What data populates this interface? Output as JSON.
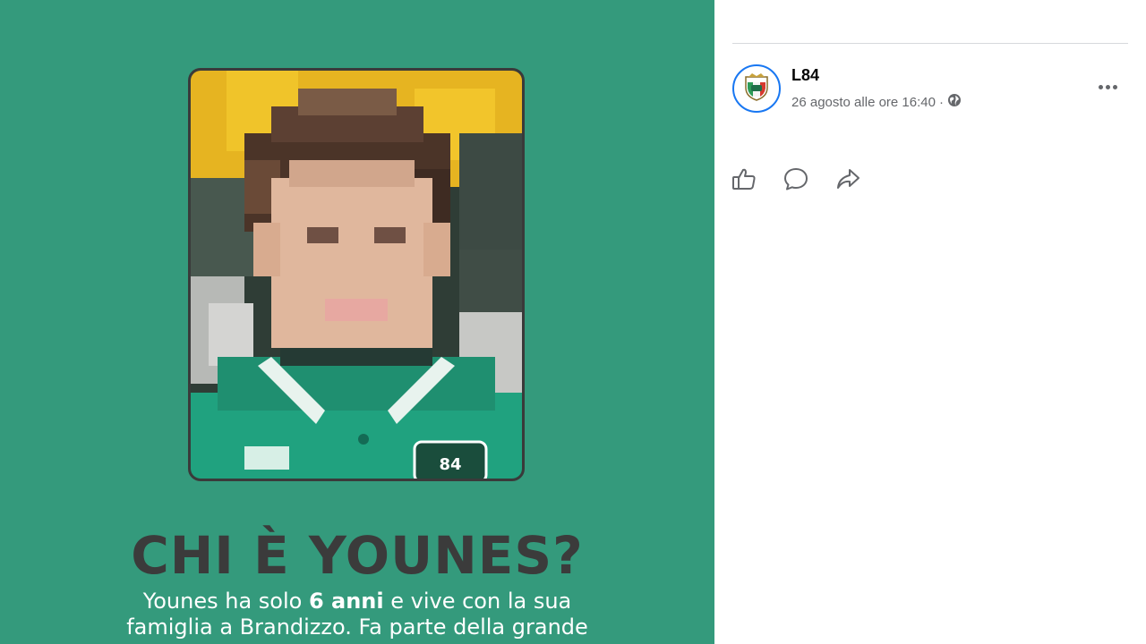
{
  "post_image": {
    "headline": "CHI È YOUNES?",
    "caption_line1_prefix": "Younes ha solo ",
    "caption_line1_bold": "6 anni",
    "caption_line1_suffix": " e vive con la sua",
    "caption_line2": "famiglia a Brandizzo. Fa parte della grande",
    "jersey_badge_text": "84",
    "colors": {
      "background": "#349a7c",
      "headline": "#3b3b3b",
      "caption": "#ffffff"
    }
  },
  "post_header": {
    "page_name": "L84",
    "timestamp": "26 agosto alle ore 16:40",
    "separator": "·",
    "audience_icon": "globe-icon",
    "avatar_icon": "club-crest-icon"
  },
  "actions": [
    {
      "name": "like",
      "icon": "thumbs-up-icon"
    },
    {
      "name": "comment",
      "icon": "speech-bubble-icon"
    },
    {
      "name": "share",
      "icon": "share-arrow-icon"
    }
  ],
  "colors": {
    "accent": "#1877f2",
    "secondary_text": "#65676b"
  }
}
